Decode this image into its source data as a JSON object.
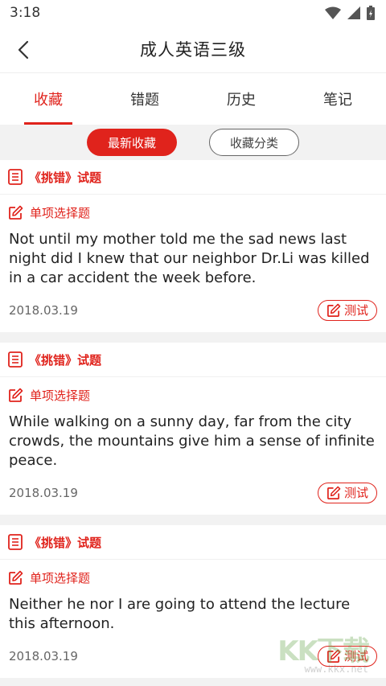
{
  "status_bar": {
    "time": "3:18"
  },
  "header": {
    "title": "成人英语三级"
  },
  "tabs": [
    {
      "label": "收藏",
      "active": true
    },
    {
      "label": "错题",
      "active": false
    },
    {
      "label": "历史",
      "active": false
    },
    {
      "label": "笔记",
      "active": false
    }
  ],
  "subtabs": {
    "latest": "最新收藏",
    "category": "收藏分类"
  },
  "cards": [
    {
      "header": "《挑错》试题",
      "type": "单项选择题",
      "question": "Not until my mother told me the sad news last night did I knew that our neighbor Dr.Li was killed in a car accident the week before.",
      "date": "2018.03.19",
      "button": "测试"
    },
    {
      "header": "《挑错》试题",
      "type": "单项选择题",
      "question": "While walking on a sunny day, far from the city crowds, the mountains give him a sense of infinite peace.",
      "date": "2018.03.19",
      "button": "测试"
    },
    {
      "header": "《挑错》试题",
      "type": "单项选择题",
      "question": "Neither he nor I are going to attend the lecture this afternoon.",
      "date": "2018.03.19",
      "button": "测试"
    }
  ],
  "watermark": {
    "logo": "KK下载",
    "url": "www.kkx.net"
  },
  "colors": {
    "accent": "#e0231c",
    "background": "#f2f2f2"
  }
}
